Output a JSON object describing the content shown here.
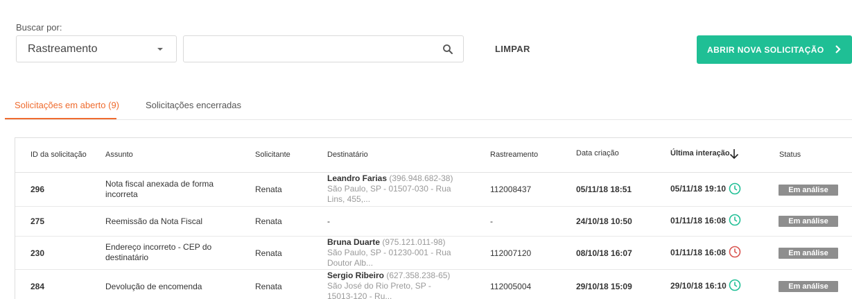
{
  "search": {
    "label": "Buscar por:",
    "filter_selected": "Rastreamento",
    "input_value": "",
    "input_placeholder": "",
    "clear_label": "LIMPAR",
    "new_request_label": "ABRIR NOVA SOLICITAÇÃO"
  },
  "tabs": [
    {
      "label": "Solicitações em aberto (9)",
      "active": true
    },
    {
      "label": "Solicitações encerradas",
      "active": false
    }
  ],
  "table": {
    "headers": {
      "id": "ID da solicitação",
      "subject": "Assunto",
      "requester": "Solicitante",
      "recipient": "Destinatário",
      "tracking": "Rastreamento",
      "created": "Data criação",
      "last": "Última interação",
      "status": "Status"
    },
    "rows": [
      {
        "id": "296",
        "subject": "Nota fiscal anexada de forma incorreta",
        "requester": "Renata",
        "recipient_name": "Leandro Farias",
        "recipient_doc": "(396.948.682-38)",
        "recipient_addr": "São Paulo, SP - 01507-030 - Rua Lins, 455,...",
        "tracking": "112008437",
        "created": "05/11/18 18:51",
        "last": "05/11/18 19:10",
        "clock": "green",
        "status": "Em análise"
      },
      {
        "id": "275",
        "subject": "Reemissão da Nota Fiscal",
        "requester": "Renata",
        "recipient_name": "",
        "recipient_doc": "",
        "recipient_addr": "-",
        "tracking": "-",
        "created": "24/10/18 10:50",
        "last": "01/11/18 16:08",
        "clock": "green",
        "status": "Em análise"
      },
      {
        "id": "230",
        "subject": "Endereço incorreto - CEP do destinatário",
        "requester": "Renata",
        "recipient_name": "Bruna Duarte",
        "recipient_doc": "(975.121.011-98)",
        "recipient_addr": "São Paulo, SP - 01230-001 - Rua Doutor Alb...",
        "tracking": "112007120",
        "created": "08/10/18 16:07",
        "last": "01/11/18 16:08",
        "clock": "red",
        "status": "Em análise"
      },
      {
        "id": "284",
        "subject": "Devolução de encomenda",
        "requester": "Renata",
        "recipient_name": "Sergio Ribeiro",
        "recipient_doc": "(627.358.238-65)",
        "recipient_addr": "São José do Rio Preto, SP - 15013-120 - Ru...",
        "tracking": "112005004",
        "created": "29/10/18 15:09",
        "last": "29/10/18 16:10",
        "clock": "green",
        "status": "Em análise"
      }
    ]
  },
  "colors": {
    "accent_orange": "#ef6b2e",
    "primary_green": "#1fbf95",
    "clock_green": "#1fbf95",
    "clock_red": "#d9534f",
    "badge_gray": "#8e8e8e"
  },
  "icons": {
    "search": "search-icon",
    "dropdown": "caret-down-icon",
    "new_request": "chevron-right-icon",
    "sort": "arrow-down-icon",
    "clock": "clock-icon"
  }
}
